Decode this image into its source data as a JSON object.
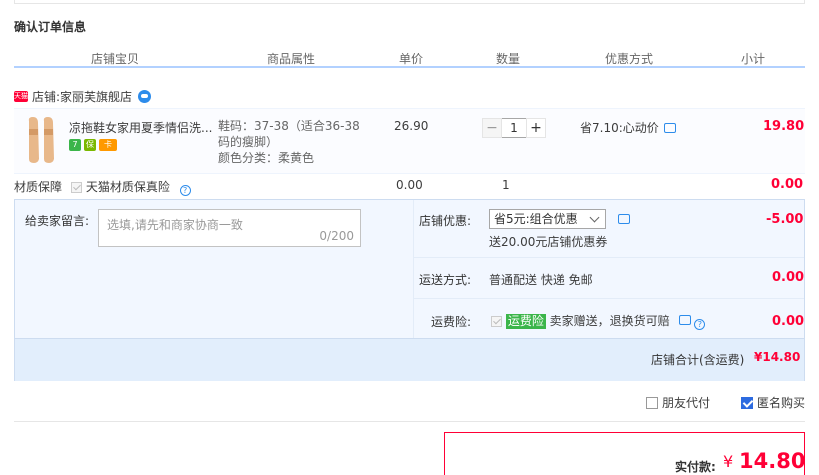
{
  "section_title": "确认订单信息",
  "columns": {
    "product": "店铺宝贝",
    "attributes": "商品属性",
    "unit_price": "单价",
    "quantity": "数量",
    "discount": "优惠方式",
    "subtotal": "小计"
  },
  "shop": {
    "label": "店铺:",
    "name": "家丽芙旗舰店"
  },
  "item": {
    "title": "凉拖鞋女家用夏季情侣洗...",
    "attr_size": "鞋码：37-38（适合36-38",
    "attr_size_cont": "码的瘦脚）",
    "attr_color": "颜色分类：柔黄色",
    "price": "26.90",
    "quantity": "1",
    "promo": "省7.10:心动价",
    "subtotal": "19.80"
  },
  "guarantee": {
    "label": "材质保障",
    "option": "天猫材质保真险",
    "price": "0.00",
    "quantity": "1",
    "subtotal": "0.00"
  },
  "message": {
    "label": "给卖家留言:",
    "placeholder": "选填,请先和商家协商一致",
    "count": "0/200"
  },
  "shop_discount": {
    "label": "店铺优惠:",
    "selected": "省5元:组合优惠",
    "note": "送20.00元店铺优惠券",
    "amount": "-5.00"
  },
  "delivery": {
    "label": "运送方式:",
    "value": "普通配送 快递 免邮",
    "amount": "0.00"
  },
  "shipping_insurance": {
    "label": "运费险:",
    "tag": "运费险",
    "desc": "卖家赠送，退换货可赔",
    "amount": "0.00"
  },
  "store_total": {
    "label": "店铺合计(含运费)",
    "amount": "¥14.80"
  },
  "options": {
    "friend_pay": "朋友代付",
    "anonymous": "匿名购买"
  },
  "payment": {
    "label": "实付款:",
    "symbol": "¥",
    "amount": "14.80"
  },
  "colors": {
    "accent_red": "#ff0036",
    "header_line": "#b2d1ff",
    "panel_bg": "#f2f7ff"
  }
}
